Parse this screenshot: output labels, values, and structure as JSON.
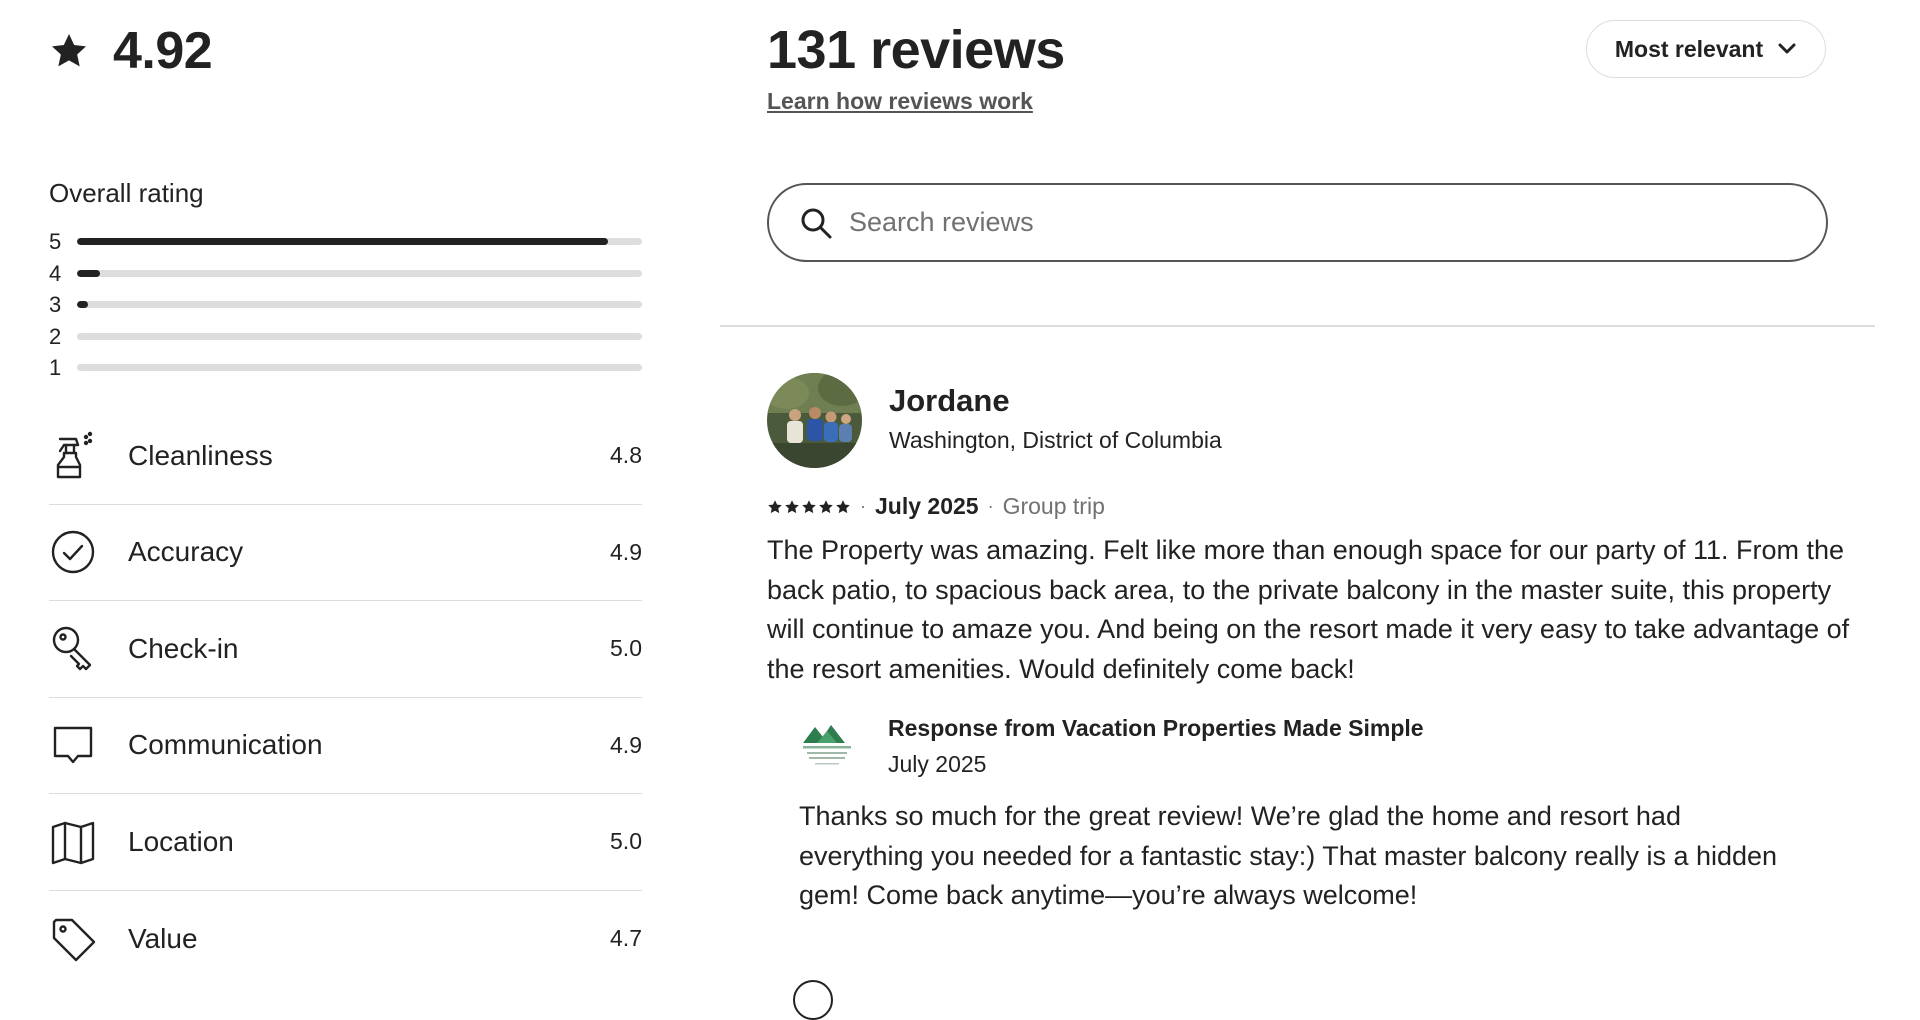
{
  "summary": {
    "rating": "4.92",
    "overall_label": "Overall rating",
    "distribution": [
      {
        "stars": "5",
        "fraction": 0.94
      },
      {
        "stars": "4",
        "fraction": 0.04
      },
      {
        "stars": "3",
        "fraction": 0.02
      },
      {
        "stars": "2",
        "fraction": 0
      },
      {
        "stars": "1",
        "fraction": 0
      }
    ],
    "categories": [
      {
        "name": "Cleanliness",
        "value": "4.8",
        "icon": "spray-bottle-icon"
      },
      {
        "name": "Accuracy",
        "value": "4.9",
        "icon": "check-circle-icon"
      },
      {
        "name": "Check-in",
        "value": "5.0",
        "icon": "key-icon"
      },
      {
        "name": "Communication",
        "value": "4.9",
        "icon": "chat-bubble-icon"
      },
      {
        "name": "Location",
        "value": "5.0",
        "icon": "map-icon"
      },
      {
        "name": "Value",
        "value": "4.7",
        "icon": "tag-icon"
      }
    ]
  },
  "header": {
    "count": "131 reviews",
    "learn_link": "Learn how reviews work",
    "sort_label": "Most relevant"
  },
  "search": {
    "placeholder": "Search reviews",
    "value": ""
  },
  "reviews": [
    {
      "name": "Jordane",
      "location": "Washington, District of Columbia",
      "stars": 5,
      "date": "July 2025",
      "trip_type": "Group trip",
      "text": "The Property was amazing. Felt like more than enough space for our party of 11. From the back patio, to spacious back area, to the private balcony in the master suite, this property will continue to amaze you. And being on the resort made it very easy to take advantage of the resort amenities. Would definitely come back!",
      "response": {
        "title": "Response from Vacation Properties Made Simple",
        "date": "July 2025",
        "text": "Thanks so much for the great review! We’re glad the home and resort had everything you needed for a fantastic stay:) That master balcony really is a hidden gem! Come back anytime—you’re always welcome!"
      }
    }
  ],
  "colors": {
    "text": "#222222",
    "muted": "#717171",
    "divider": "#dddddd",
    "bar_track": "#dddddd",
    "bar_fill": "#222222",
    "host_logo_green": "#2e7d4f"
  }
}
